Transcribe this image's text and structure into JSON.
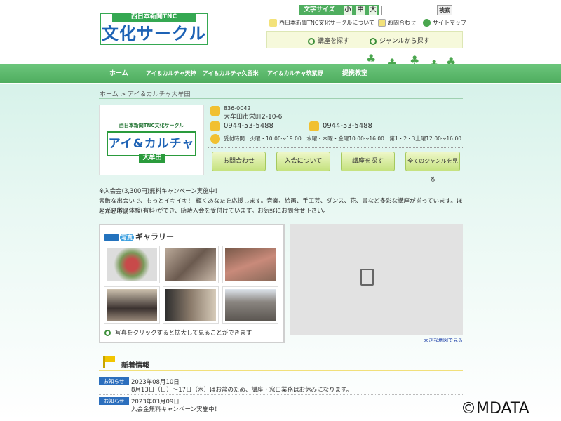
{
  "header": {
    "logo_sub": "西日本新聞TNC",
    "logo_main": "文化サークル",
    "font_size_label": "文字サイズ",
    "font_sizes": [
      "小",
      "中",
      "大"
    ],
    "search_button": "検索",
    "links": [
      "西日本新聞TNC文化サークルについて",
      "お問合わせ",
      "サイトマップ"
    ],
    "find_course": "講座を探す",
    "find_genre": "ジャンルから探す"
  },
  "nav": [
    "ホーム",
    "アイ＆カルチャ天神",
    "アイ＆カルチャ久留米",
    "アイ＆カルチャ筑紫野",
    "提携教室"
  ],
  "breadcrumb": "ホーム > アイ＆カルチャ大牟田",
  "shop": {
    "logo_sub": "西日本新聞TNC文化サークル",
    "logo_main": "アイ&カルチャ",
    "logo_place": "大牟田",
    "postal": "836-0042",
    "address": "大牟田市栄町2-10-6",
    "tel": "0944-53-5488",
    "fax": "0944-53-5488",
    "hours": "受付時間　火曜・10:00～19:00　水曜・木曜・金曜10:00～16:00　第1・2・3土曜12:00～16:00"
  },
  "buttons": [
    "お問合わせ",
    "入会について",
    "講座を探す",
    "全てのジャンルを見る"
  ],
  "notice": {
    "line1": "※入会金(3,300円)無料キャンペーン実施中！",
    "line2": "素敵な出会いで、もっとイキイキ！ 輝くあなたを応援します。音楽、絵画、手工芸、ダンス、花、書など多彩な講座が揃っています。ほとんどの講",
    "line3": "座が見学、体験(有料)ができ、随時入会を受付けています。お気軽にお問合せ下さい。"
  },
  "gallery": {
    "title_badge": "写真",
    "title": "ギャラリー",
    "footer": "写真をクリックすると拡大して見ることができます"
  },
  "map_link": "大きな地図で見る",
  "news": {
    "title": "新着情報",
    "items": [
      {
        "badge": "お知らせ",
        "date": "2023年08月10日",
        "text": "8月13日（日）～17日（木）はお盆のため、講座・窓口業務はお休みになります。"
      },
      {
        "badge": "お知らせ",
        "date": "2023年03月09日",
        "text": "入会金無料キャンペーン実施中！"
      }
    ]
  },
  "watermark": "©MDATA",
  "colors": {
    "brand_green": "#4eac5e",
    "brand_blue": "#1d62b5",
    "badge_blue": "#2c6fbd"
  }
}
